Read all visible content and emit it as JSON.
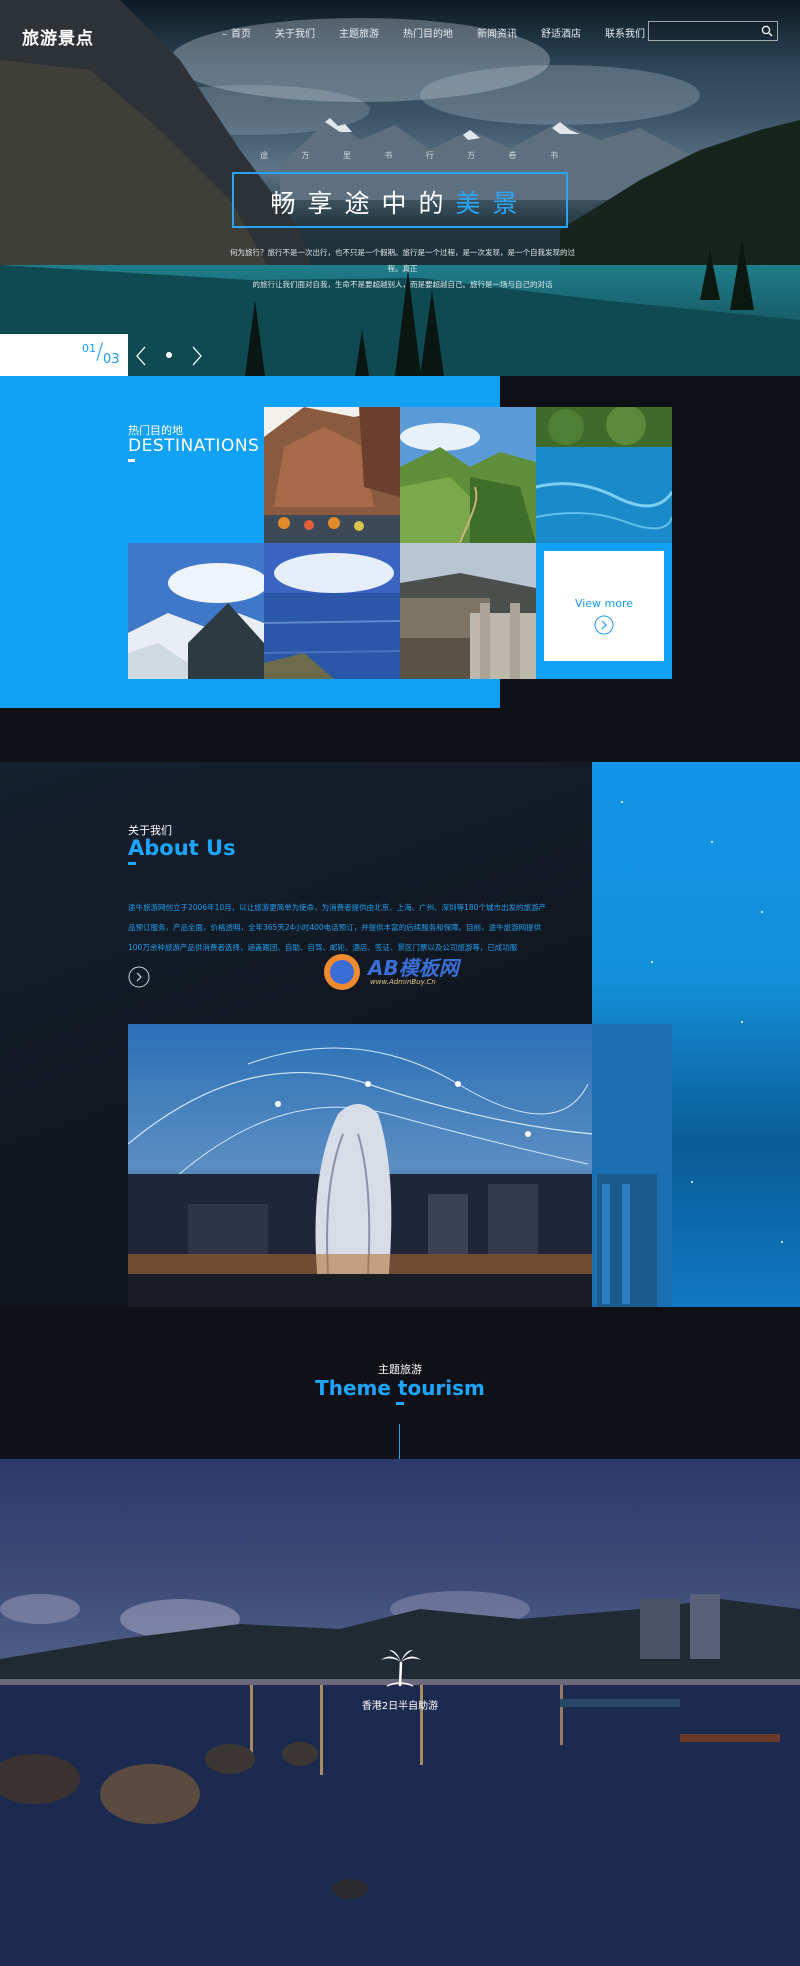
{
  "logo": "旅游景点",
  "nav": [
    "首页",
    "关于我们",
    "主题旅游",
    "热门目的地",
    "新闻资讯",
    "舒适酒店",
    "联系我们"
  ],
  "search": {
    "placeholder": "",
    "icon": "search-icon"
  },
  "hero": {
    "small_words": [
      "途",
      "万",
      "里",
      "书",
      "行",
      "万",
      "卷",
      "书"
    ],
    "title_pre": "畅享途中的",
    "title_hl": "美景",
    "desc_line1": "何为旅行？旅行不是一次出行，也不只是一个假期。旅行是一个过程，是一次发现，是一个自我发现的过程。真正",
    "desc_line2": "的旅行让我们面对自我，生命不是要超越别人，而是要超越自己。旅行是一场与自己的对话",
    "pager_current": "01",
    "pager_total": "03"
  },
  "destinations": {
    "label_cn": "热门目的地",
    "label_en": "DESTINATIONS",
    "view_more": "View more"
  },
  "about": {
    "label_cn": "关于我们",
    "label_en": "About Us",
    "text": "途牛旅游网创立于2006年10月，以让旅游更简单为使命，为消费者提供由北京、上海、广州、深圳等180个城市出发的旅游产品预订服务，产品全面，价格透明，全年365天24小时400电话预订，并提供丰富的后续服务和保障。目前，途牛旅游网提供100万余种旅游产品供消费者选择，涵盖跟团、自助、自驾、邮轮、酒店、签证、景区门票以及公司旅游等，已成功服",
    "watermark": "AB模板网",
    "watermark_sub": "www.AdminBuy.Cn"
  },
  "theme": {
    "label_cn": "主题旅游",
    "label_en": "Theme tourism",
    "feature": "香港2日半自助游"
  },
  "colors": {
    "accent": "#1da5ff",
    "blue_panel": "#12a2f5",
    "dark": "#0f1116"
  }
}
